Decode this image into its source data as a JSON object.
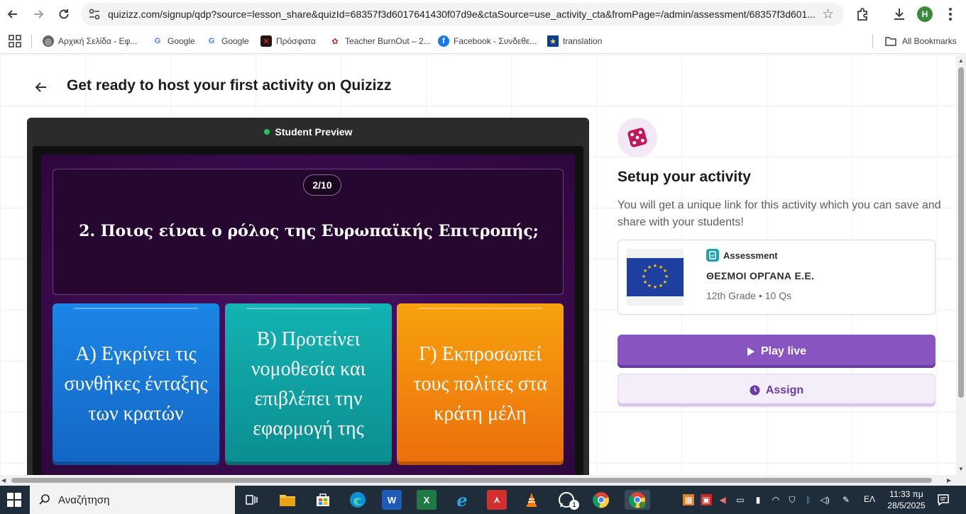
{
  "browser": {
    "url": "quizizz.com/signup/qdp?source=lesson_share&quizId=68357f3d6017641430f07d9e&ctaSource=use_activity_cta&fromPage=/admin/assessment/68357f3d601...",
    "profile_initial": "H"
  },
  "bookmarks": {
    "items": [
      {
        "label": "Αρχική Σελίδα - Εφ..."
      },
      {
        "label": "Google"
      },
      {
        "label": "Google"
      },
      {
        "label": "Πρόσφατα"
      },
      {
        "label": "Teacher BurnOut – 2..."
      },
      {
        "label": "Facebook - Συνδεθε..."
      },
      {
        "label": "translation"
      }
    ],
    "all_bookmarks": "All Bookmarks"
  },
  "page": {
    "title": "Get ready to host your first activity on Quizizz"
  },
  "preview": {
    "header": "Student Preview",
    "counter": "2/10",
    "question": "2. Ποιος είναι ο ρόλος της Ευρωπαϊκής Επιτροπής;",
    "options": [
      {
        "text": "A) Εγκρίνει τις συνθήκες ένταξης των κρατών",
        "color": "#1b86e6"
      },
      {
        "text": "B) Προτείνει νομοθεσία και επιβλέπει την εφαρμογή της",
        "color": "#14b3b3"
      },
      {
        "text": "Γ) Εκπροσωπεί τους πολίτες στα κράτη μέλη",
        "color": "#f7a20e"
      }
    ]
  },
  "setup": {
    "title": "Setup your activity",
    "description": "You will get a unique link for this activity which you can save and share with your students!",
    "quiz": {
      "type": "Assessment",
      "name": "ΘΕΣΜΟΙ ΟΡΓΑΝΑ Ε.Ε.",
      "meta": "12th Grade • 10 Qs"
    },
    "play_live": "Play live",
    "assign": "Assign",
    "accent": "#8854c0"
  },
  "taskbar": {
    "search_placeholder": "Αναζήτηση",
    "whatsapp_badge": "1",
    "language": "ΕΛ",
    "time": "11:33 πμ",
    "date": "28/5/2025"
  }
}
